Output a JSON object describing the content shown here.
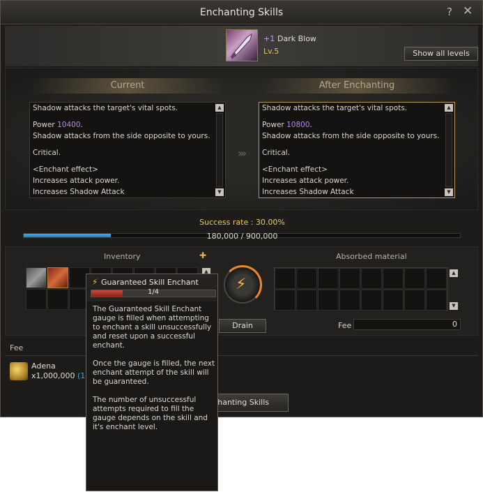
{
  "window": {
    "title": "Enchanting Skills",
    "help": "?",
    "close": "✕"
  },
  "skill": {
    "plus": "+1",
    "name": "Dark Blow",
    "level": "Lv.5",
    "icon": "dark-blow-skill-icon",
    "show_all_label": "Show all levels"
  },
  "current": {
    "heading": "Current",
    "line1": "Shadow attacks the target's vital spots.",
    "power_label": "Power",
    "power_value": "10400",
    "power_suffix": ".",
    "line3": "Shadow attacks from the side opposite to yours.",
    "line4": "Critical.",
    "effect_title": "<Enchant effect>",
    "effect1": "Increases attack power.",
    "effect2": "Increases Shadow Attack"
  },
  "after": {
    "heading": "After Enchanting",
    "line1": "Shadow attacks the target's vital spots.",
    "power_label": "Power",
    "power_value": "10800",
    "power_suffix": ".",
    "line3": "Shadow attacks from the side opposite to yours.",
    "line4": "Critical.",
    "effect_title": "<Enchant effect>",
    "effect1": "Increases attack power.",
    "effect2": "Increases Shadow Attack"
  },
  "success": {
    "label": "Success rate : 30.00%",
    "progress_text": "180,000 / 900,000",
    "progress_fraction": 0.2
  },
  "inventory": {
    "label": "Inventory"
  },
  "absorbed": {
    "label": "Absorbed material",
    "fee_label": "Fee",
    "fee_value": "0"
  },
  "drain_label": "Drain",
  "fee": {
    "section_label": "Fee",
    "currency_name": "Adena",
    "amount": "x1,000,000",
    "owned": "(11,1"
  },
  "enchant_button_label": "nchanting Skills",
  "tooltip": {
    "title": "Guaranteed Skill Enchant",
    "gauge_text": "1/4",
    "gauge_fraction": 0.25,
    "para1": "The Guaranteed Skill Enchant gauge is filled when attempting to enchant a skill unsuccessfully and reset upon a successful enchant.",
    "para2": "Once the gauge is filled, the next enchant attempt of the skill will be guaranteed.",
    "para3": "The number of unsuccessful attempts required to fill the gauge depends on the skill and it's enchant level."
  },
  "colors": {
    "accent_purple": "#b689f0",
    "success_yellow": "#e8cc60",
    "progress_blue": "#3fb4f0",
    "gauge_red": "#c84a3a"
  }
}
